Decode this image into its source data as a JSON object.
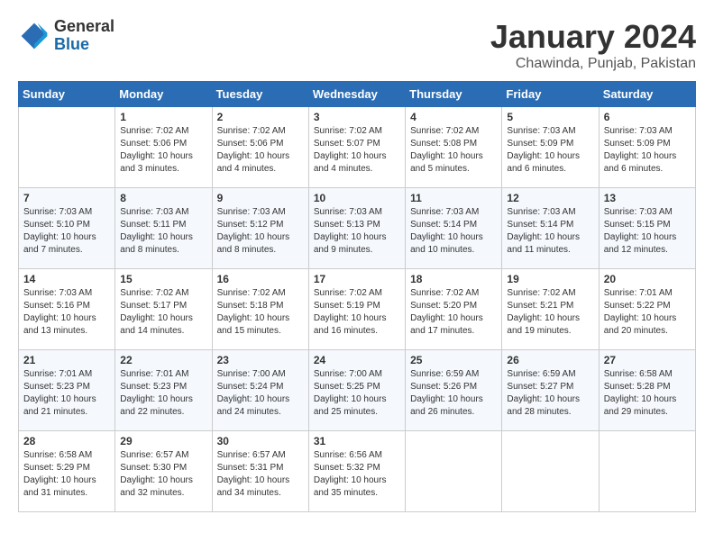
{
  "header": {
    "logo_general": "General",
    "logo_blue": "Blue",
    "month": "January 2024",
    "location": "Chawinda, Punjab, Pakistan"
  },
  "calendar": {
    "days_of_week": [
      "Sunday",
      "Monday",
      "Tuesday",
      "Wednesday",
      "Thursday",
      "Friday",
      "Saturday"
    ],
    "weeks": [
      [
        {
          "day": "",
          "content": ""
        },
        {
          "day": "1",
          "content": "Sunrise: 7:02 AM\nSunset: 5:06 PM\nDaylight: 10 hours\nand 3 minutes."
        },
        {
          "day": "2",
          "content": "Sunrise: 7:02 AM\nSunset: 5:06 PM\nDaylight: 10 hours\nand 4 minutes."
        },
        {
          "day": "3",
          "content": "Sunrise: 7:02 AM\nSunset: 5:07 PM\nDaylight: 10 hours\nand 4 minutes."
        },
        {
          "day": "4",
          "content": "Sunrise: 7:02 AM\nSunset: 5:08 PM\nDaylight: 10 hours\nand 5 minutes."
        },
        {
          "day": "5",
          "content": "Sunrise: 7:03 AM\nSunset: 5:09 PM\nDaylight: 10 hours\nand 6 minutes."
        },
        {
          "day": "6",
          "content": "Sunrise: 7:03 AM\nSunset: 5:09 PM\nDaylight: 10 hours\nand 6 minutes."
        }
      ],
      [
        {
          "day": "7",
          "content": "Sunrise: 7:03 AM\nSunset: 5:10 PM\nDaylight: 10 hours\nand 7 minutes."
        },
        {
          "day": "8",
          "content": "Sunrise: 7:03 AM\nSunset: 5:11 PM\nDaylight: 10 hours\nand 8 minutes."
        },
        {
          "day": "9",
          "content": "Sunrise: 7:03 AM\nSunset: 5:12 PM\nDaylight: 10 hours\nand 8 minutes."
        },
        {
          "day": "10",
          "content": "Sunrise: 7:03 AM\nSunset: 5:13 PM\nDaylight: 10 hours\nand 9 minutes."
        },
        {
          "day": "11",
          "content": "Sunrise: 7:03 AM\nSunset: 5:14 PM\nDaylight: 10 hours\nand 10 minutes."
        },
        {
          "day": "12",
          "content": "Sunrise: 7:03 AM\nSunset: 5:14 PM\nDaylight: 10 hours\nand 11 minutes."
        },
        {
          "day": "13",
          "content": "Sunrise: 7:03 AM\nSunset: 5:15 PM\nDaylight: 10 hours\nand 12 minutes."
        }
      ],
      [
        {
          "day": "14",
          "content": "Sunrise: 7:03 AM\nSunset: 5:16 PM\nDaylight: 10 hours\nand 13 minutes."
        },
        {
          "day": "15",
          "content": "Sunrise: 7:02 AM\nSunset: 5:17 PM\nDaylight: 10 hours\nand 14 minutes."
        },
        {
          "day": "16",
          "content": "Sunrise: 7:02 AM\nSunset: 5:18 PM\nDaylight: 10 hours\nand 15 minutes."
        },
        {
          "day": "17",
          "content": "Sunrise: 7:02 AM\nSunset: 5:19 PM\nDaylight: 10 hours\nand 16 minutes."
        },
        {
          "day": "18",
          "content": "Sunrise: 7:02 AM\nSunset: 5:20 PM\nDaylight: 10 hours\nand 17 minutes."
        },
        {
          "day": "19",
          "content": "Sunrise: 7:02 AM\nSunset: 5:21 PM\nDaylight: 10 hours\nand 19 minutes."
        },
        {
          "day": "20",
          "content": "Sunrise: 7:01 AM\nSunset: 5:22 PM\nDaylight: 10 hours\nand 20 minutes."
        }
      ],
      [
        {
          "day": "21",
          "content": "Sunrise: 7:01 AM\nSunset: 5:23 PM\nDaylight: 10 hours\nand 21 minutes."
        },
        {
          "day": "22",
          "content": "Sunrise: 7:01 AM\nSunset: 5:23 PM\nDaylight: 10 hours\nand 22 minutes."
        },
        {
          "day": "23",
          "content": "Sunrise: 7:00 AM\nSunset: 5:24 PM\nDaylight: 10 hours\nand 24 minutes."
        },
        {
          "day": "24",
          "content": "Sunrise: 7:00 AM\nSunset: 5:25 PM\nDaylight: 10 hours\nand 25 minutes."
        },
        {
          "day": "25",
          "content": "Sunrise: 6:59 AM\nSunset: 5:26 PM\nDaylight: 10 hours\nand 26 minutes."
        },
        {
          "day": "26",
          "content": "Sunrise: 6:59 AM\nSunset: 5:27 PM\nDaylight: 10 hours\nand 28 minutes."
        },
        {
          "day": "27",
          "content": "Sunrise: 6:58 AM\nSunset: 5:28 PM\nDaylight: 10 hours\nand 29 minutes."
        }
      ],
      [
        {
          "day": "28",
          "content": "Sunrise: 6:58 AM\nSunset: 5:29 PM\nDaylight: 10 hours\nand 31 minutes."
        },
        {
          "day": "29",
          "content": "Sunrise: 6:57 AM\nSunset: 5:30 PM\nDaylight: 10 hours\nand 32 minutes."
        },
        {
          "day": "30",
          "content": "Sunrise: 6:57 AM\nSunset: 5:31 PM\nDaylight: 10 hours\nand 34 minutes."
        },
        {
          "day": "31",
          "content": "Sunrise: 6:56 AM\nSunset: 5:32 PM\nDaylight: 10 hours\nand 35 minutes."
        },
        {
          "day": "",
          "content": ""
        },
        {
          "day": "",
          "content": ""
        },
        {
          "day": "",
          "content": ""
        }
      ]
    ]
  }
}
